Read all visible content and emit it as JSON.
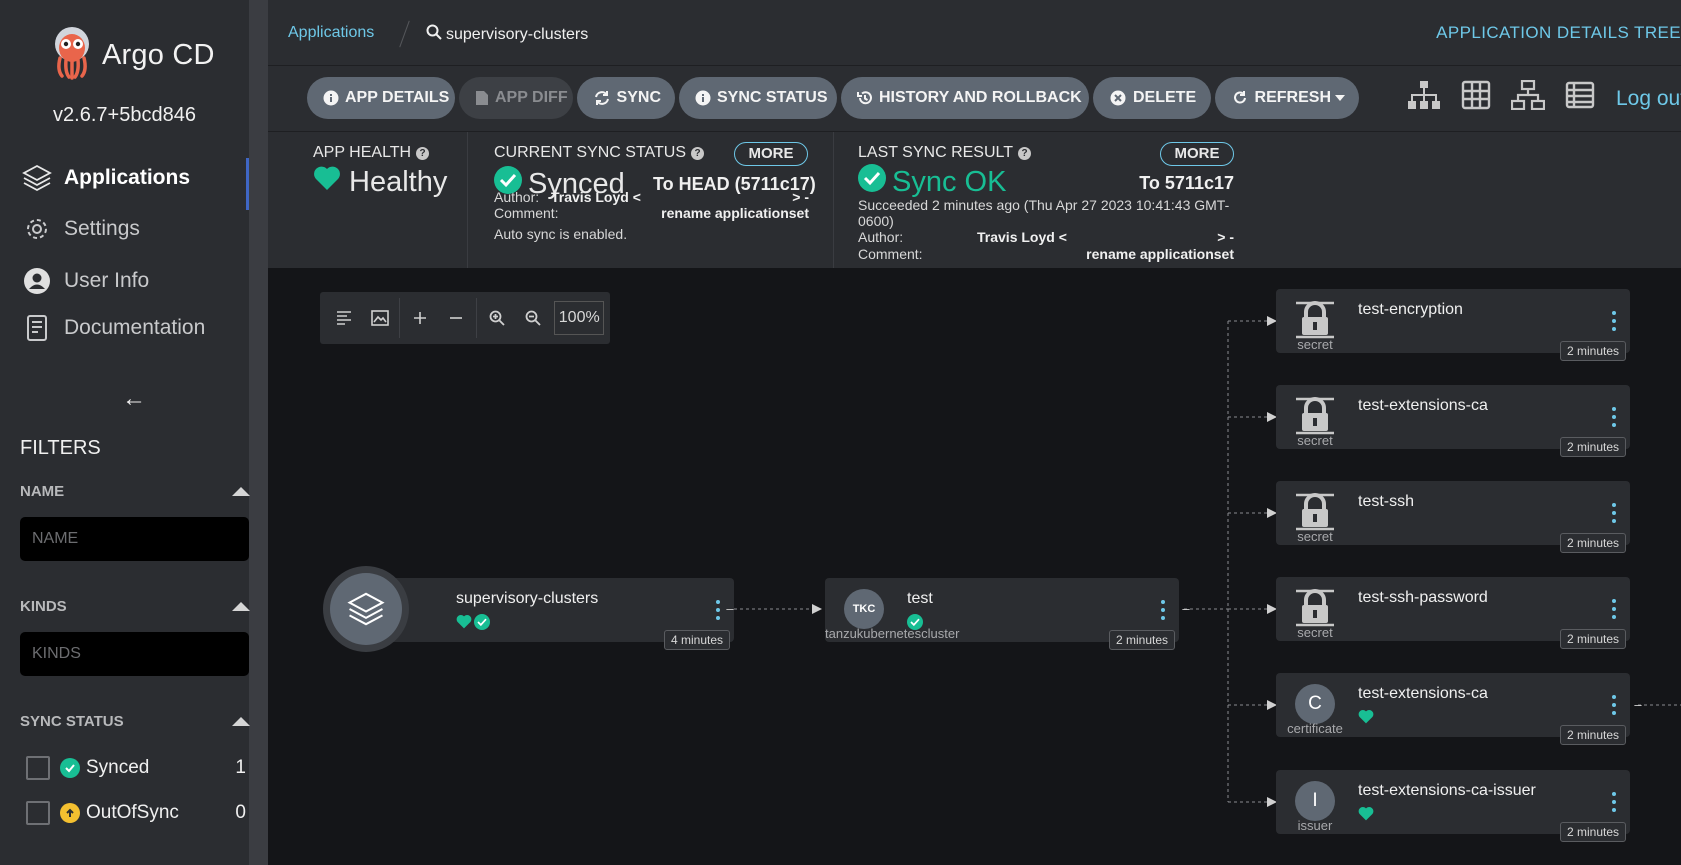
{
  "app": {
    "brand": "Argo CD",
    "version": "v2.6.7+5bcd846"
  },
  "sidebar": {
    "nav": [
      {
        "label": "Applications",
        "icon": "stack-icon"
      },
      {
        "label": "Settings",
        "icon": "gear-icon"
      },
      {
        "label": "User Info",
        "icon": "user-icon"
      },
      {
        "label": "Documentation",
        "icon": "book-icon"
      }
    ],
    "filters_title": "FILTERS",
    "name_filter": {
      "label": "NAME",
      "placeholder": "NAME"
    },
    "kinds_filter": {
      "label": "KINDS",
      "placeholder": "KINDS"
    },
    "sync_status": {
      "label": "SYNC STATUS",
      "items": [
        {
          "label": "Synced",
          "count": "1",
          "color": "#18be94"
        },
        {
          "label": "OutOfSync",
          "count": "0",
          "color": "#f4c030"
        }
      ]
    }
  },
  "topbar": {
    "breadcrumb_link": "Applications",
    "breadcrumb_current": "supervisory-clusters",
    "view_title": "APPLICATION DETAILS TREE"
  },
  "toolbar": {
    "buttons": [
      {
        "label": "APP DETAILS",
        "icon": "info-icon"
      },
      {
        "label": "APP DIFF",
        "icon": "file-icon"
      },
      {
        "label": "SYNC",
        "icon": "sync-icon"
      },
      {
        "label": "SYNC STATUS",
        "icon": "info-icon"
      },
      {
        "label": "HISTORY AND ROLLBACK",
        "icon": "history-icon"
      },
      {
        "label": "DELETE",
        "icon": "close-circle-icon"
      },
      {
        "label": "REFRESH",
        "icon": "refresh-icon"
      }
    ],
    "logout": "Log out"
  },
  "status": {
    "health": {
      "label": "APP HEALTH",
      "value": "Healthy"
    },
    "current_sync": {
      "label": "CURRENT SYNC STATUS",
      "more": "MORE",
      "value": "Synced",
      "target": "To HEAD (5711c17)",
      "author_label": "Author:",
      "author": "Travis Loyd <",
      "author_tail": "> -",
      "comment_label": "Comment:",
      "comment": "rename applicationset",
      "auto_sync": "Auto sync is enabled."
    },
    "last_sync": {
      "label": "LAST SYNC RESULT",
      "more": "MORE",
      "value": "Sync OK",
      "target": "To 5711c17",
      "succeeded_line1": "Succeeded 2 minutes ago (Thu Apr 27 2023 10:41:43 GMT-",
      "succeeded_line2": "0600)",
      "author_label": "Author:",
      "author": "Travis Loyd <",
      "author_tail": "> -",
      "comment_label": "Comment:",
      "comment": "rename applicationset"
    }
  },
  "zoom": {
    "level": "100%"
  },
  "tree": {
    "root": {
      "name": "supervisory-clusters",
      "age": "4 minutes"
    },
    "tkc": {
      "name": "test",
      "kind": "tanzukubernetescluster",
      "icon_text": "TKC",
      "age": "2 minutes"
    },
    "children": [
      {
        "name": "test-encryption",
        "kind": "secret",
        "age": "2 minutes"
      },
      {
        "name": "test-extensions-ca",
        "kind": "secret",
        "age": "2 minutes"
      },
      {
        "name": "test-ssh",
        "kind": "secret",
        "age": "2 minutes"
      },
      {
        "name": "test-ssh-password",
        "kind": "secret",
        "age": "2 minutes"
      },
      {
        "name": "test-extensions-ca",
        "kind": "certificate",
        "icon_text": "C",
        "age": "2 minutes"
      },
      {
        "name": "test-extensions-ca-issuer",
        "kind": "issuer",
        "icon_text": "I",
        "age": "2 minutes"
      }
    ]
  },
  "colors": {
    "accent": "#6ec8e8",
    "healthy": "#18be94",
    "button": "#5f6873"
  }
}
